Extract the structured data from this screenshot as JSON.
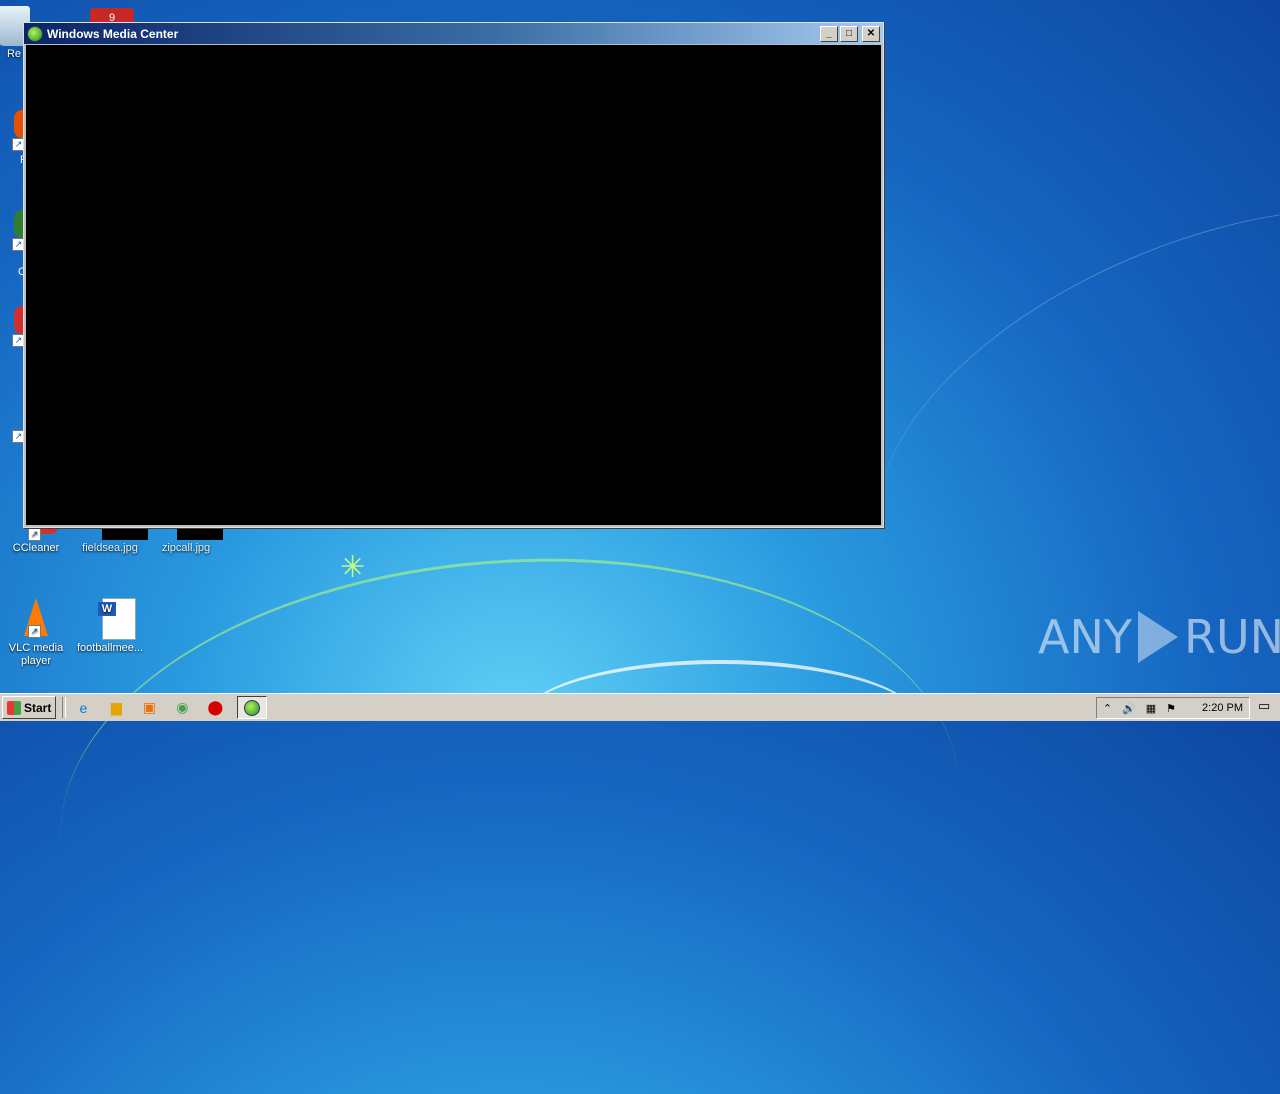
{
  "window": {
    "title": "Windows Media Center"
  },
  "desktop": {
    "partial_labels": [
      "Re",
      "F",
      "C"
    ],
    "icons": [
      {
        "label": "CCleaner"
      },
      {
        "label": "fieldsea.jpg"
      },
      {
        "label": "zipcall.jpg"
      },
      {
        "label": "VLC media player"
      },
      {
        "label": "footballmee..."
      }
    ],
    "badge": "9"
  },
  "taskbar": {
    "start_label": "Start",
    "clock": "2:20 PM"
  },
  "watermark": {
    "left": "ANY",
    "right": "RUN"
  }
}
